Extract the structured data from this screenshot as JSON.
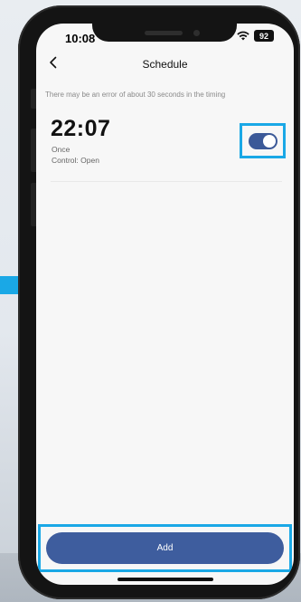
{
  "status_bar": {
    "time": "10:08",
    "battery": "92",
    "wifi_icon": "wifi-icon"
  },
  "header": {
    "back_icon": "chevron-left-icon",
    "title": "Schedule"
  },
  "notice": "There may be an error of about 30 seconds in the timing",
  "schedules": [
    {
      "time": "22:07",
      "repeat": "Once",
      "control": "Control: Open",
      "enabled": true
    }
  ],
  "add_button": {
    "label": "Add"
  },
  "colors": {
    "accent": "#3e5d9e",
    "highlight": "#1aa8e6",
    "screen_bg": "#f7f7f7"
  }
}
